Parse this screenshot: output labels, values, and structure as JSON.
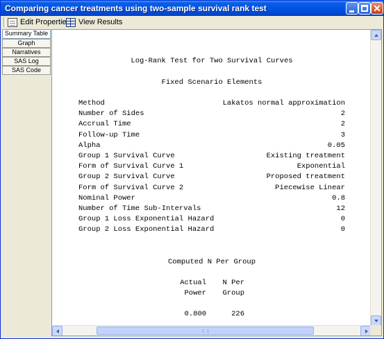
{
  "window": {
    "title": "Comparing cancer treatments using two-sample survival rank test",
    "controls": {
      "minimize": "_",
      "maximize": "□",
      "close": "✕"
    }
  },
  "toolbar": {
    "edit_properties": "Edit Properties",
    "view_results": "View Results"
  },
  "nav": {
    "items": [
      {
        "label": "Summary Table",
        "active": true
      },
      {
        "label": "Graph",
        "active": false
      },
      {
        "label": "Narratives",
        "active": false
      },
      {
        "label": "SAS Log",
        "active": false
      },
      {
        "label": "SAS Code",
        "active": false
      }
    ]
  },
  "report": {
    "title": "Log-Rank Test for Two Survival Curves",
    "section_title": "Fixed Scenario Elements",
    "rows": [
      {
        "label": "Method",
        "value": "Lakatos normal approximation"
      },
      {
        "label": "Number of Sides",
        "value": "2"
      },
      {
        "label": "Accrual Time",
        "value": "2"
      },
      {
        "label": "Follow-up Time",
        "value": "3"
      },
      {
        "label": "Alpha",
        "value": "0.05"
      },
      {
        "label": "Group 1 Survival Curve",
        "value": "Existing treatment"
      },
      {
        "label": "Form of Survival Curve 1",
        "value": "Exponential"
      },
      {
        "label": "Group 2 Survival Curve",
        "value": "Proposed treatment"
      },
      {
        "label": "Form of Survival Curve 2",
        "value": "Piecewise Linear"
      },
      {
        "label": "Nominal Power",
        "value": "0.8"
      },
      {
        "label": "Number of Time Sub-Intervals",
        "value": "12"
      },
      {
        "label": "Group 1 Loss Exponential Hazard",
        "value": "0"
      },
      {
        "label": "Group 2 Loss Exponential Hazard",
        "value": "0"
      }
    ],
    "computed_title": "Computed N Per Group",
    "table": {
      "header1": [
        "Actual",
        "N Per"
      ],
      "header2": [
        "Power",
        "Group"
      ],
      "row": [
        "0.800",
        "226"
      ]
    }
  },
  "colors": {
    "titlebar": "#0054e3",
    "background": "#ece9d8",
    "content": "#ffffff"
  }
}
